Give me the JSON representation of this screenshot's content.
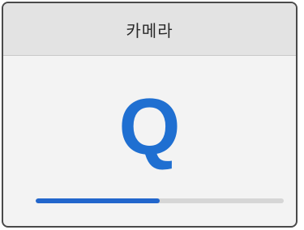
{
  "panel": {
    "title": "카메라",
    "letter": "Q",
    "progress_percent": 50
  },
  "colors": {
    "accent": "#1f6fd1",
    "progress_fill": "#2266cc",
    "progress_track": "#d6d6d6",
    "header_bg": "#e3e3e3",
    "panel_bg": "#f3f3f3"
  }
}
